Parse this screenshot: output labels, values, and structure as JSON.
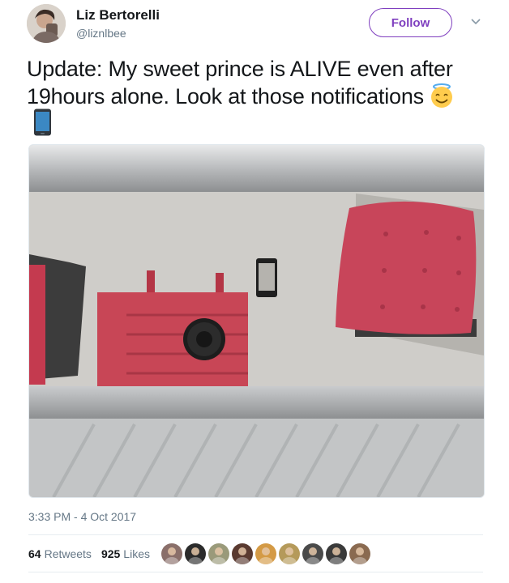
{
  "user": {
    "name": "Liz Bertorelli",
    "handle": "@liznlbee"
  },
  "header": {
    "follow_label": "Follow",
    "menu_icon": "chevron-down-icon"
  },
  "tweet": {
    "text": "Update: My sweet prince is ALIVE even after 19hours alone. Look at those notifications",
    "emojis": [
      "smiling-face-with-halo-icon",
      "mobile-phone-icon"
    ],
    "timestamp": "3:33 PM - 4 Oct 2017"
  },
  "stats": {
    "retweets_count": "64",
    "retweets_label": "Retweets",
    "likes_count": "925",
    "likes_label": "Likes"
  },
  "likers": [
    {
      "icon": "avatar",
      "color": "#8a6f6a"
    },
    {
      "icon": "avatar",
      "color": "#2b2b2b"
    },
    {
      "icon": "avatar",
      "color": "#9a9a7a"
    },
    {
      "icon": "avatar",
      "color": "#5a3a30"
    },
    {
      "icon": "avatar",
      "color": "#d49a45"
    },
    {
      "icon": "avatar",
      "color": "#b59a5a"
    },
    {
      "icon": "avatar",
      "color": "#4a4a4a"
    },
    {
      "icon": "avatar",
      "color": "#3a3a3a"
    },
    {
      "icon": "avatar",
      "color": "#8a6a50"
    }
  ],
  "colors": {
    "follow_accent": "#7f3fbf",
    "secondary_text": "#657786"
  }
}
